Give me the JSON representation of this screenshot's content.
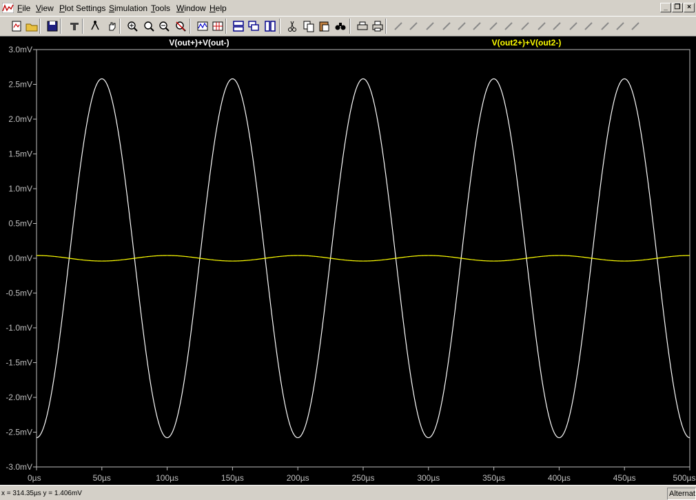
{
  "menu": [
    "File",
    "View",
    "Plot Settings",
    "Simulation",
    "Tools",
    "Window",
    "Help"
  ],
  "mdi_buttons": [
    "minimize-icon",
    "restore-icon",
    "close-icon"
  ],
  "toolbar_icons": [
    "new-schematic-icon",
    "open-icon",
    "save-icon",
    "control-panel-icon",
    "run-icon",
    "halt-icon",
    "zoom-in-icon",
    "zoom-pan-icon",
    "zoom-out-icon",
    "zoom-fit-icon",
    "autorange-icon",
    "grid-icon",
    "tile-horizontal-icon",
    "cascade-icon",
    "tile-vertical-icon",
    "cut-icon",
    "copy-icon",
    "paste-icon",
    "find-icon",
    "print-preview-icon",
    "print-icon",
    "wire-icon",
    "ground-icon",
    "label-net-icon",
    "resistor-icon",
    "capacitor-icon",
    "inductor-icon",
    "diode-icon",
    "component-icon",
    "move-icon",
    "drag-icon",
    "undo-icon",
    "redo-icon",
    "rotate-icon",
    "mirror-icon",
    "text-icon",
    "spice-directive-icon"
  ],
  "chart_data": {
    "type": "line",
    "x": {
      "min": 0,
      "max": 500,
      "unit": "µs",
      "tick_values": [
        0,
        50,
        100,
        150,
        200,
        250,
        300,
        350,
        400,
        450,
        500
      ],
      "tick_labels": [
        "0µs",
        "50µs",
        "100µs",
        "150µs",
        "200µs",
        "250µs",
        "300µs",
        "350µs",
        "400µs",
        "450µs",
        "500µs"
      ]
    },
    "y": {
      "min": -3.0,
      "max": 3.0,
      "unit": "mV",
      "tick_values": [
        3.0,
        2.5,
        2.0,
        1.5,
        1.0,
        0.5,
        0.0,
        -0.5,
        -1.0,
        -1.5,
        -2.0,
        -2.5,
        -3.0
      ],
      "tick_labels": [
        "3.0mV",
        "2.5mV",
        "2.0mV",
        "1.5mV",
        "1.0mV",
        "0.5mV",
        "0.0mV",
        "-0.5mV",
        "-1.0mV",
        "-1.5mV",
        "-2.0mV",
        "-2.5mV",
        "-3.0mV"
      ]
    },
    "grid": false,
    "series": [
      {
        "name": "V(out+)+V(out-)",
        "color": "#ffffff",
        "amplitude": 2.58,
        "period": 100,
        "peak_at": 50,
        "offset": 0.0
      },
      {
        "name": "V(out2+)+V(out2-)",
        "color": "#ffff00",
        "amplitude": 0.04,
        "period": 100,
        "peak_at": 0,
        "offset": 0.0
      }
    ]
  },
  "status": {
    "readout": "x = 314.35µs    y = 1.406mV",
    "mode": "Alternate"
  }
}
